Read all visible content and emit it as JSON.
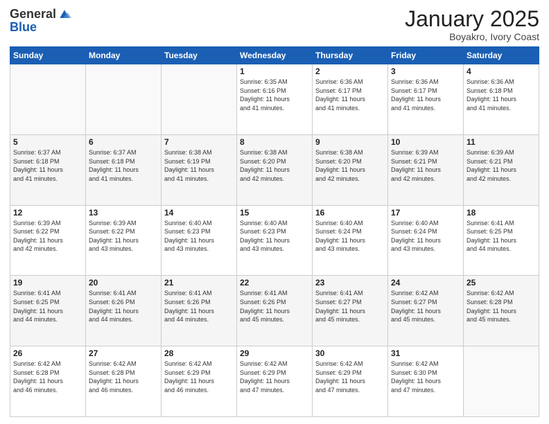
{
  "logo": {
    "general": "General",
    "blue": "Blue"
  },
  "title": "January 2025",
  "subtitle": "Boyakro, Ivory Coast",
  "days_of_week": [
    "Sunday",
    "Monday",
    "Tuesday",
    "Wednesday",
    "Thursday",
    "Friday",
    "Saturday"
  ],
  "weeks": [
    [
      {
        "day": "",
        "info": ""
      },
      {
        "day": "",
        "info": ""
      },
      {
        "day": "",
        "info": ""
      },
      {
        "day": "1",
        "info": "Sunrise: 6:35 AM\nSunset: 6:16 PM\nDaylight: 11 hours\nand 41 minutes."
      },
      {
        "day": "2",
        "info": "Sunrise: 6:36 AM\nSunset: 6:17 PM\nDaylight: 11 hours\nand 41 minutes."
      },
      {
        "day": "3",
        "info": "Sunrise: 6:36 AM\nSunset: 6:17 PM\nDaylight: 11 hours\nand 41 minutes."
      },
      {
        "day": "4",
        "info": "Sunrise: 6:36 AM\nSunset: 6:18 PM\nDaylight: 11 hours\nand 41 minutes."
      }
    ],
    [
      {
        "day": "5",
        "info": "Sunrise: 6:37 AM\nSunset: 6:18 PM\nDaylight: 11 hours\nand 41 minutes."
      },
      {
        "day": "6",
        "info": "Sunrise: 6:37 AM\nSunset: 6:18 PM\nDaylight: 11 hours\nand 41 minutes."
      },
      {
        "day": "7",
        "info": "Sunrise: 6:38 AM\nSunset: 6:19 PM\nDaylight: 11 hours\nand 41 minutes."
      },
      {
        "day": "8",
        "info": "Sunrise: 6:38 AM\nSunset: 6:20 PM\nDaylight: 11 hours\nand 42 minutes."
      },
      {
        "day": "9",
        "info": "Sunrise: 6:38 AM\nSunset: 6:20 PM\nDaylight: 11 hours\nand 42 minutes."
      },
      {
        "day": "10",
        "info": "Sunrise: 6:39 AM\nSunset: 6:21 PM\nDaylight: 11 hours\nand 42 minutes."
      },
      {
        "day": "11",
        "info": "Sunrise: 6:39 AM\nSunset: 6:21 PM\nDaylight: 11 hours\nand 42 minutes."
      }
    ],
    [
      {
        "day": "12",
        "info": "Sunrise: 6:39 AM\nSunset: 6:22 PM\nDaylight: 11 hours\nand 42 minutes."
      },
      {
        "day": "13",
        "info": "Sunrise: 6:39 AM\nSunset: 6:22 PM\nDaylight: 11 hours\nand 43 minutes."
      },
      {
        "day": "14",
        "info": "Sunrise: 6:40 AM\nSunset: 6:23 PM\nDaylight: 11 hours\nand 43 minutes."
      },
      {
        "day": "15",
        "info": "Sunrise: 6:40 AM\nSunset: 6:23 PM\nDaylight: 11 hours\nand 43 minutes."
      },
      {
        "day": "16",
        "info": "Sunrise: 6:40 AM\nSunset: 6:24 PM\nDaylight: 11 hours\nand 43 minutes."
      },
      {
        "day": "17",
        "info": "Sunrise: 6:40 AM\nSunset: 6:24 PM\nDaylight: 11 hours\nand 43 minutes."
      },
      {
        "day": "18",
        "info": "Sunrise: 6:41 AM\nSunset: 6:25 PM\nDaylight: 11 hours\nand 44 minutes."
      }
    ],
    [
      {
        "day": "19",
        "info": "Sunrise: 6:41 AM\nSunset: 6:25 PM\nDaylight: 11 hours\nand 44 minutes."
      },
      {
        "day": "20",
        "info": "Sunrise: 6:41 AM\nSunset: 6:26 PM\nDaylight: 11 hours\nand 44 minutes."
      },
      {
        "day": "21",
        "info": "Sunrise: 6:41 AM\nSunset: 6:26 PM\nDaylight: 11 hours\nand 44 minutes."
      },
      {
        "day": "22",
        "info": "Sunrise: 6:41 AM\nSunset: 6:26 PM\nDaylight: 11 hours\nand 45 minutes."
      },
      {
        "day": "23",
        "info": "Sunrise: 6:41 AM\nSunset: 6:27 PM\nDaylight: 11 hours\nand 45 minutes."
      },
      {
        "day": "24",
        "info": "Sunrise: 6:42 AM\nSunset: 6:27 PM\nDaylight: 11 hours\nand 45 minutes."
      },
      {
        "day": "25",
        "info": "Sunrise: 6:42 AM\nSunset: 6:28 PM\nDaylight: 11 hours\nand 45 minutes."
      }
    ],
    [
      {
        "day": "26",
        "info": "Sunrise: 6:42 AM\nSunset: 6:28 PM\nDaylight: 11 hours\nand 46 minutes."
      },
      {
        "day": "27",
        "info": "Sunrise: 6:42 AM\nSunset: 6:28 PM\nDaylight: 11 hours\nand 46 minutes."
      },
      {
        "day": "28",
        "info": "Sunrise: 6:42 AM\nSunset: 6:29 PM\nDaylight: 11 hours\nand 46 minutes."
      },
      {
        "day": "29",
        "info": "Sunrise: 6:42 AM\nSunset: 6:29 PM\nDaylight: 11 hours\nand 47 minutes."
      },
      {
        "day": "30",
        "info": "Sunrise: 6:42 AM\nSunset: 6:29 PM\nDaylight: 11 hours\nand 47 minutes."
      },
      {
        "day": "31",
        "info": "Sunrise: 6:42 AM\nSunset: 6:30 PM\nDaylight: 11 hours\nand 47 minutes."
      },
      {
        "day": "",
        "info": ""
      }
    ]
  ]
}
